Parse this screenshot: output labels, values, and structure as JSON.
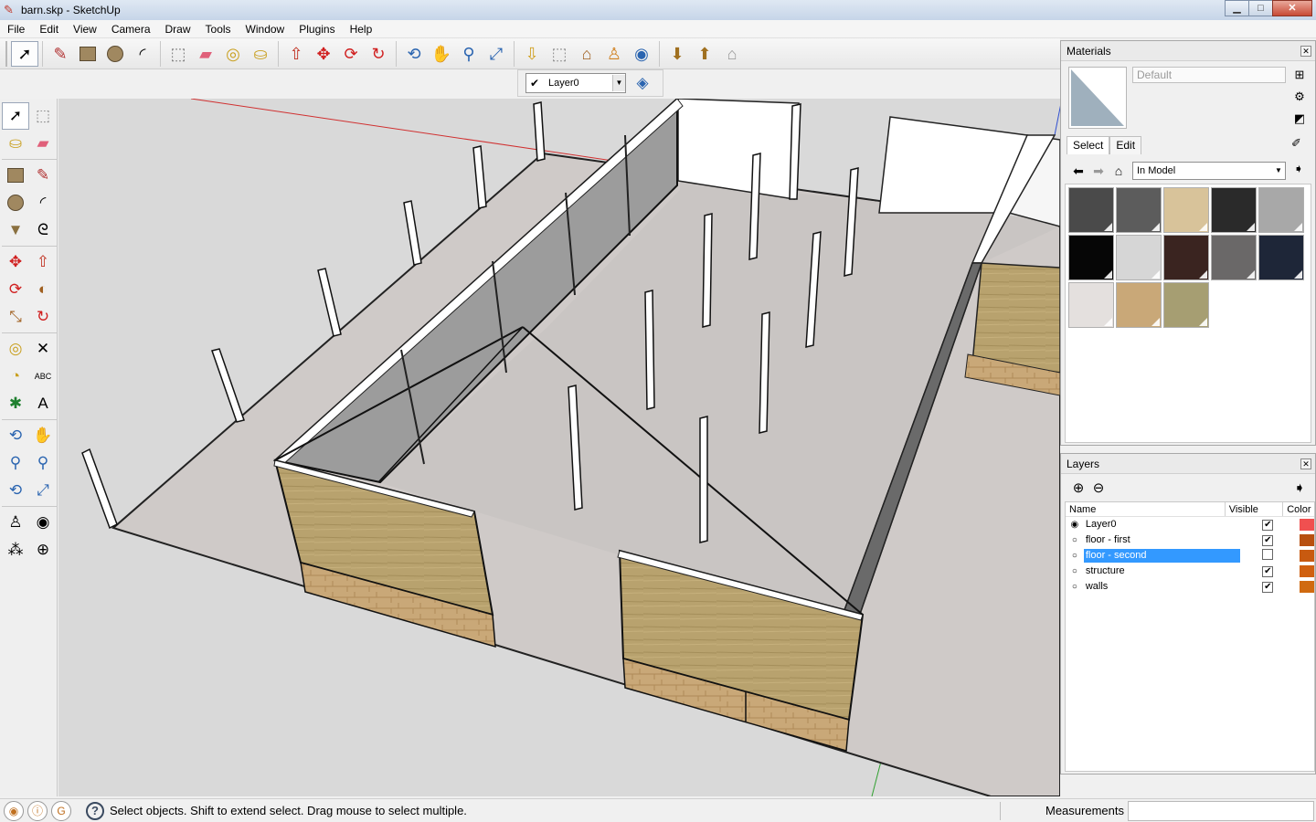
{
  "window": {
    "title": "barn.skp - SketchUp",
    "minimize": "▁",
    "maximize": "□",
    "close": "✕"
  },
  "menu": [
    "File",
    "Edit",
    "View",
    "Camera",
    "Draw",
    "Tools",
    "Window",
    "Plugins",
    "Help"
  ],
  "toolbar": {
    "icons": [
      "select-icon",
      "line-icon",
      "rectangle-icon",
      "circle-icon",
      "arc-icon",
      "make-component-icon",
      "eraser-icon",
      "tape-measure-icon",
      "paint-bucket-icon",
      "push-pull-icon",
      "move-icon",
      "rotate-icon",
      "follow-me-icon",
      "orbit-icon",
      "pan-icon",
      "zoom-icon",
      "zoom-extents-icon",
      "get-models-icon",
      "share-model-icon",
      "share-component-icon",
      "photo-textures-icon",
      "google-earth-icon",
      "warehouse-icon",
      "import-icon",
      "preview-icon"
    ]
  },
  "layer_toolbar": {
    "current_layer": "Layer0",
    "check": "✔"
  },
  "materials": {
    "title": "Materials",
    "name_placeholder": "Default",
    "tabs": [
      "Select",
      "Edit"
    ],
    "collection": "In Model",
    "swatch_colors": [
      "#4a4a4a",
      "#5c5c5c",
      "#d8c39a",
      "#2a2a2a",
      "#a8a8a8",
      "#060606",
      "#d6d6d6",
      "#3a2420",
      "#6a6868",
      "#1e2638",
      "#e4e0de",
      "#c9a878",
      "#a69e72"
    ]
  },
  "layers": {
    "title": "Layers",
    "columns": {
      "name": "Name",
      "visible": "Visible",
      "color": "Color"
    },
    "rows": [
      {
        "name": "Layer0",
        "active": true,
        "visible": true,
        "color": "#f05050"
      },
      {
        "name": "floor - first",
        "active": false,
        "visible": true,
        "color": "#b85010"
      },
      {
        "name": "floor - second",
        "active": false,
        "visible": false,
        "color": "#c85a10",
        "selected": true
      },
      {
        "name": "structure",
        "active": false,
        "visible": true,
        "color": "#d06010"
      },
      {
        "name": "walls",
        "active": false,
        "visible": true,
        "color": "#d06a10"
      }
    ]
  },
  "status": {
    "message": "Select objects. Shift to extend select. Drag mouse to select multiple.",
    "measurements_label": "Measurements",
    "help": "?"
  }
}
